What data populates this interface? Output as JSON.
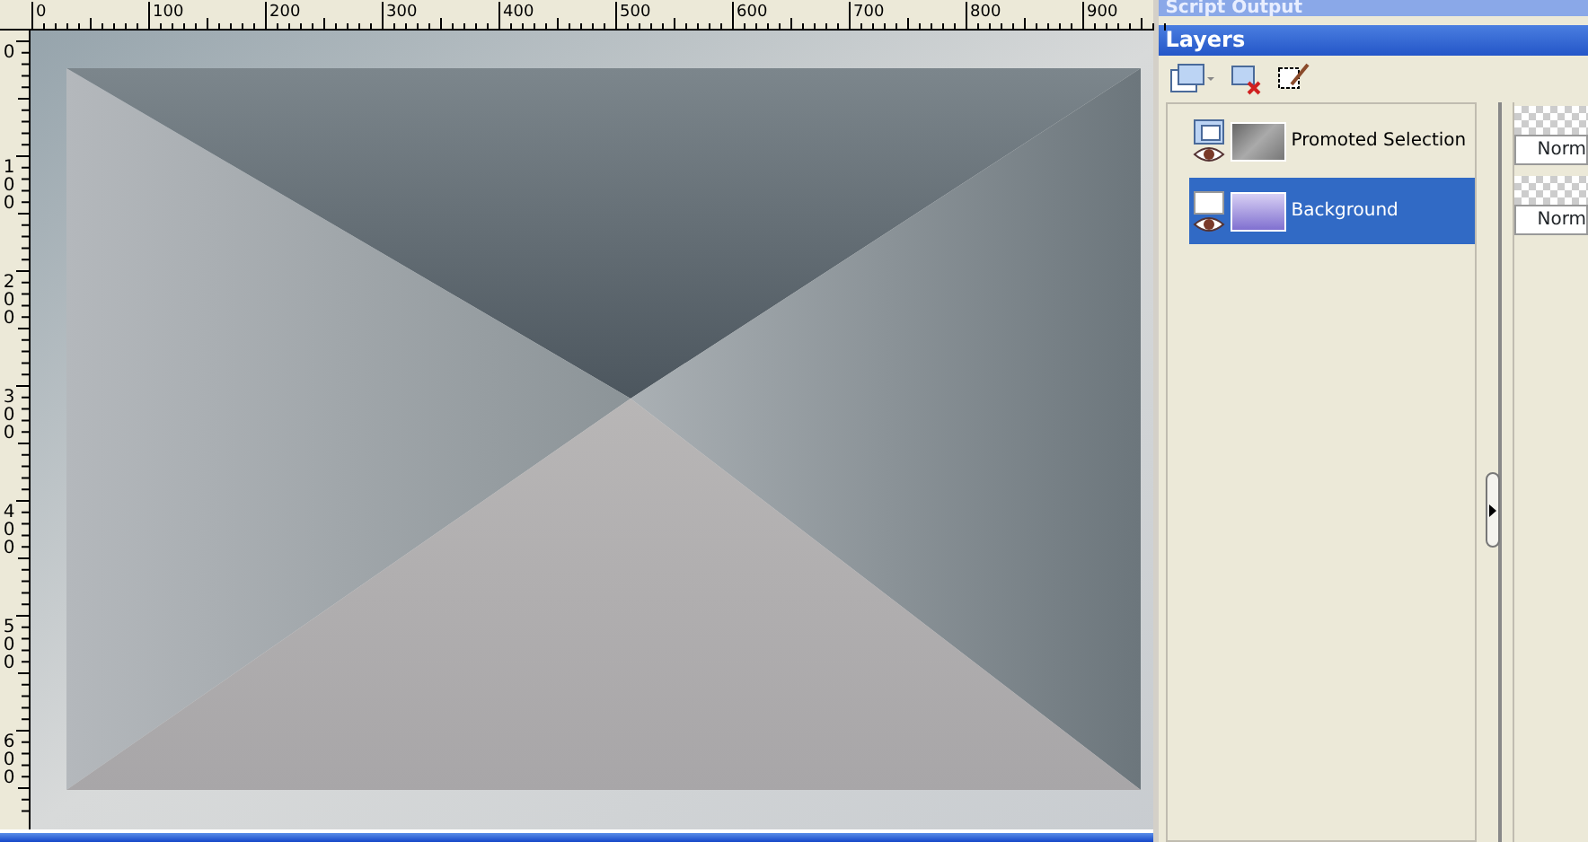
{
  "rulers": {
    "horizontal": [
      "0",
      "100",
      "200",
      "300",
      "400",
      "500",
      "600",
      "700",
      "800",
      "900"
    ],
    "vertical": [
      "0",
      "100",
      "200",
      "300",
      "400",
      "500",
      "600"
    ]
  },
  "palettes": [
    {
      "title": "Script Output"
    },
    {
      "title": "Layers"
    }
  ],
  "layers": [
    {
      "name": "Promoted Selection",
      "selected": false,
      "kind": "selection"
    },
    {
      "name": "Background",
      "selected": true,
      "kind": "raster"
    }
  ],
  "blend_modes": [
    "Norm",
    "Norm"
  ]
}
